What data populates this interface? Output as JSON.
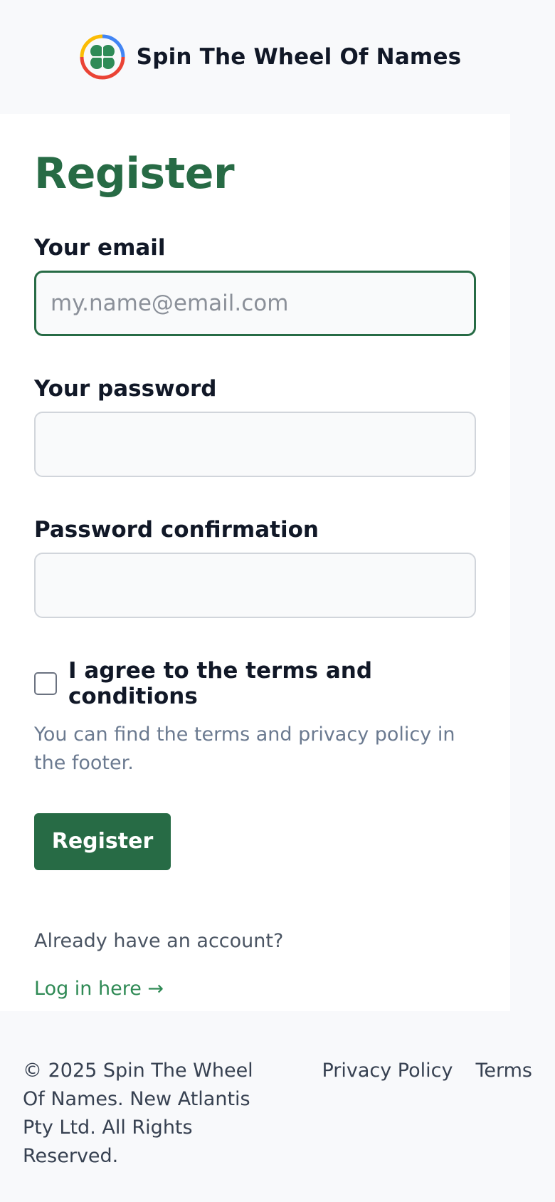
{
  "header": {
    "brand": "Spin The Wheel Of Names",
    "logo_icon": "four-leaf-clover-icon"
  },
  "form": {
    "title": "Register",
    "email": {
      "label": "Your email",
      "placeholder": "my.name@email.com",
      "value": ""
    },
    "password": {
      "label": "Your password",
      "value": ""
    },
    "password_confirmation": {
      "label": "Password confirmation",
      "value": ""
    },
    "agree": {
      "label": "I agree to the terms and conditions",
      "checked": false
    },
    "hint": "You can find the terms and privacy policy in the footer.",
    "submit_label": "Register",
    "already_text": "Already have an account?",
    "login_link": "Log in here →"
  },
  "footer": {
    "copyright": "© 2025 Spin The Wheel Of Names. New Atlantis Pty Ltd. All Rights Reserved.",
    "links": [
      "Privacy Policy",
      "Terms"
    ]
  },
  "colors": {
    "accent": "#276b45",
    "link": "#2f8a55",
    "page_bg": "#f8f9fb"
  }
}
